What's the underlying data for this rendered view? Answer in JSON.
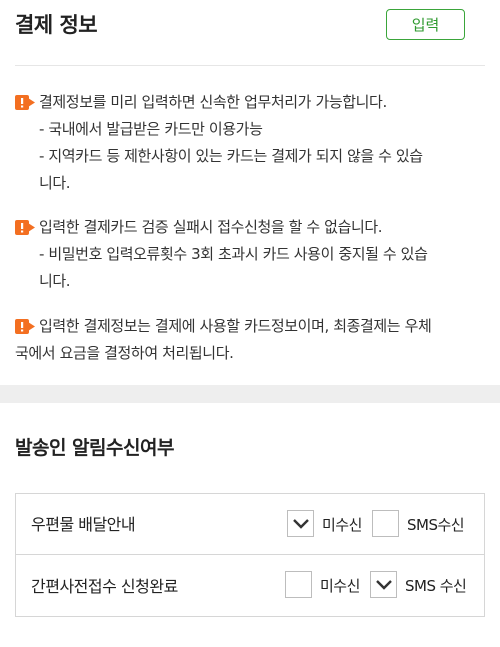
{
  "header": {
    "title": "결제 정보",
    "input_button": "입력"
  },
  "notices": [
    {
      "main": "결제정보를 미리 입력하면 신속한 업무처리가 가능합니다.",
      "subs": [
        "- 국내에서 발급받은 카드만 이용가능",
        "- 지역카드 등 제한사항이 있는 카드는 결제가 되지 않을 수 있습",
        "니다."
      ]
    },
    {
      "main": "입력한 결제카드 검증 실패시 접수신청을 할 수 없습니다.",
      "subs": [
        "- 비밀번호 입력오류횟수 3회 초과시 카드 사용이 중지될 수 있습",
        "니다."
      ]
    },
    {
      "main": "입력한 결제정보는 결제에 사용할 카드정보이며, 최종결제는 우체",
      "subs": [
        "국에서 요금을 결정하여 처리됩니다."
      ]
    }
  ],
  "notification": {
    "title": "발송인 알림수신여부",
    "rows": [
      {
        "label": "우편물 배달안내",
        "opt1": {
          "label": "미수신",
          "checked": true
        },
        "opt2": {
          "label": "SMS수신",
          "checked": false
        }
      },
      {
        "label": "간편사전접수 신청완료",
        "opt1": {
          "label": "미수신",
          "checked": false
        },
        "opt2": {
          "label": "SMS 수신",
          "checked": true
        }
      }
    ]
  },
  "colors": {
    "accent": "#3aa53a",
    "notice_icon": "#f36f21"
  }
}
